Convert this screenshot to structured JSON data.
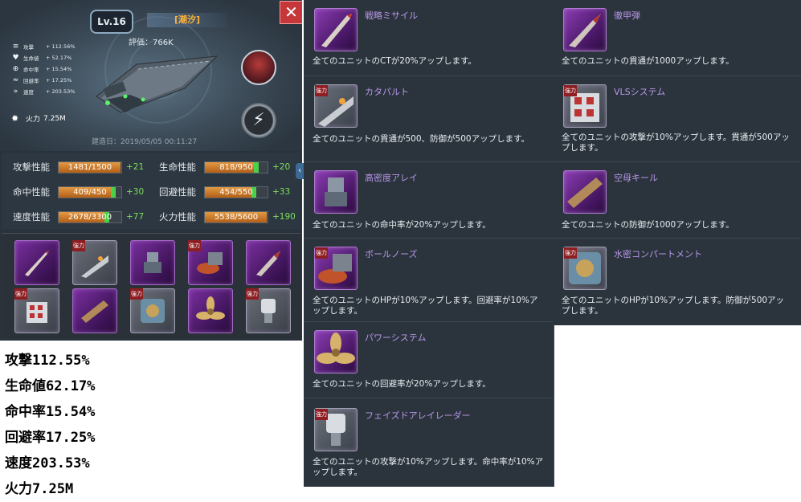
{
  "ship": {
    "level": "Lv.16",
    "name": "[潮汐]",
    "rating": "評価：766K",
    "close": "✕",
    "small_stats": [
      {
        "icon": "≡",
        "label": "攻撃",
        "value": "+ 112.56%"
      },
      {
        "icon": "♥",
        "label": "生命値",
        "value": "+ 52.17%"
      },
      {
        "icon": "⊕",
        "label": "命中率",
        "value": "+ 15.54%"
      },
      {
        "icon": "≈",
        "label": "回避率",
        "value": "+ 17.25%"
      },
      {
        "icon": "»",
        "label": "速度",
        "value": "+ 203.53%"
      }
    ],
    "firepower_label": "火力",
    "firepower_value": "7.25M",
    "build_date": "建造日：2019/05/05 00:11:27"
  },
  "stats": [
    {
      "label": "攻撃性能",
      "text": "1481/1500",
      "fill": 0.987,
      "bonus": "+21"
    },
    {
      "label": "生命性能",
      "text": "818/950",
      "fill": 0.861,
      "bonus": "+20"
    },
    {
      "label": "命中性能",
      "text": "409/450",
      "fill": 0.909,
      "bonus": "+30"
    },
    {
      "label": "回避性能",
      "text": "454/550",
      "fill": 0.825,
      "bonus": "+33"
    },
    {
      "label": "速度性能",
      "text": "2678/3300",
      "fill": 0.812,
      "bonus": "+77"
    },
    {
      "label": "火力性能",
      "text": "5538/5600",
      "fill": 0.989,
      "bonus": "+190"
    }
  ],
  "equipment_slots": [
    {
      "name": "missile",
      "tag": ""
    },
    {
      "name": "catapult",
      "tag": "強力"
    },
    {
      "name": "array",
      "tag": ""
    },
    {
      "name": "ball-nose",
      "tag": "強力"
    },
    {
      "name": "ap-shell",
      "tag": ""
    },
    {
      "name": "vls",
      "tag": "強力"
    },
    {
      "name": "keel",
      "tag": ""
    },
    {
      "name": "compartment",
      "tag": "強力"
    },
    {
      "name": "propeller",
      "tag": ""
    },
    {
      "name": "radar",
      "tag": "強力"
    }
  ],
  "percents": [
    "攻撃112.55%",
    "生命値62.17%",
    "命中率15.54%",
    "回避率17.25%",
    "速度203.53%",
    "火力7.25M"
  ],
  "modules_col1": [
    {
      "title": "戦略ミサイル",
      "desc": "全てのユニットのCTが20%アップします。",
      "tag": ""
    },
    {
      "title": "カタパルト",
      "desc": "全てのユニットの貫通が500、防御が500アップします。",
      "tag": "強力"
    },
    {
      "title": "高密度アレイ",
      "desc": "全てのユニットの命中率が20%アップします。",
      "tag": ""
    },
    {
      "title": "ボールノーズ",
      "desc": "全てのユニットのHPが10%アップします。回避率が10%アップします。",
      "tag": "強力"
    },
    {
      "title": "パワーシステム",
      "desc": "全てのユニットの回避率が20%アップします。",
      "tag": ""
    },
    {
      "title": "フェイズドアレイレーダー",
      "desc": "全てのユニットの攻撃が10%アップします。命中率が10%アップします。",
      "tag": "強力"
    }
  ],
  "modules_col2": [
    {
      "title": "徹甲弾",
      "desc": "全てのユニットの貫通が1000アップします。",
      "tag": ""
    },
    {
      "title": "VLSシステム",
      "desc": "全てのユニットの攻撃が10%アップします。貫通が500アップします。",
      "tag": "強力"
    },
    {
      "title": "空母キール",
      "desc": "全てのユニットの防御が1000アップします。",
      "tag": ""
    },
    {
      "title": "水密コンパートメント",
      "desc": "全てのユニットのHPが10%アップします。防御が500アップします。",
      "tag": "強力"
    }
  ],
  "colors": {
    "accent_purple": "#b896e8",
    "bonus_green": "#7ddf5a",
    "name_gold": "#ffb23a",
    "close_red": "#c6373a"
  }
}
